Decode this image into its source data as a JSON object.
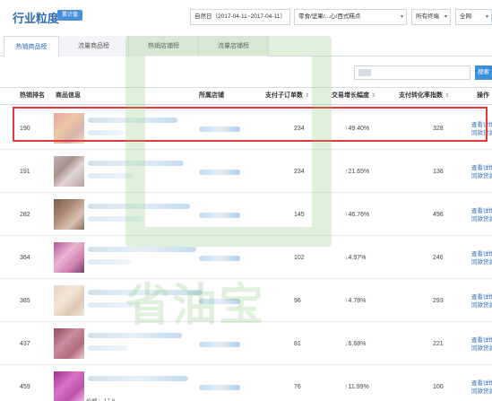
{
  "header": {
    "title": "行业粒度",
    "badge": "累计值",
    "date_range": "自然日（2017-04-11~2017-04-11）",
    "category": "零食/坚果/...心/西式糕点",
    "terminal": "所有终端",
    "region": "全网"
  },
  "tabs": [
    {
      "label": "热销商品榜",
      "active": true
    },
    {
      "label": "流量商品榜",
      "active": false
    },
    {
      "label": "热销店铺榜",
      "active": false
    },
    {
      "label": "流量店铺榜",
      "active": false
    }
  ],
  "search": {
    "button_label": "搜索"
  },
  "table": {
    "headers": {
      "rank": "热销排名",
      "product": "商品信息",
      "shop": "所属店铺",
      "orders": "支付子订单数",
      "growth": "交易增长幅度",
      "conversion": "支付转化率指数",
      "action": "操作"
    },
    "sort_glyph": "⇕",
    "action_lines": [
      "查看详情",
      "同款货源"
    ],
    "price_label": "价格：17.8",
    "rows": [
      {
        "rank": "190",
        "orders": "234",
        "growth": "49.40%",
        "trend": "up",
        "conversion": "328"
      },
      {
        "rank": "191",
        "orders": "234",
        "growth": "21.65%",
        "trend": "up",
        "conversion": "136"
      },
      {
        "rank": "282",
        "orders": "145",
        "growth": "46.76%",
        "trend": "up",
        "conversion": "496"
      },
      {
        "rank": "364",
        "orders": "102",
        "growth": "4.97%",
        "trend": "down",
        "conversion": "246"
      },
      {
        "rank": "385",
        "orders": "96",
        "growth": "4.78%",
        "trend": "up",
        "conversion": "293"
      },
      {
        "rank": "437",
        "orders": "81",
        "growth": "6.68%",
        "trend": "down",
        "conversion": "221"
      },
      {
        "rank": "459",
        "orders": "76",
        "growth": "11.99%",
        "trend": "up",
        "conversion": "100"
      }
    ]
  },
  "watermark": {
    "text": "省油宝"
  },
  "colors": {
    "accent": "#2e6db4",
    "up": "#e0423a",
    "down": "#2fa84f",
    "highlight": "#e23a3a",
    "watermark": "#70be5a"
  }
}
